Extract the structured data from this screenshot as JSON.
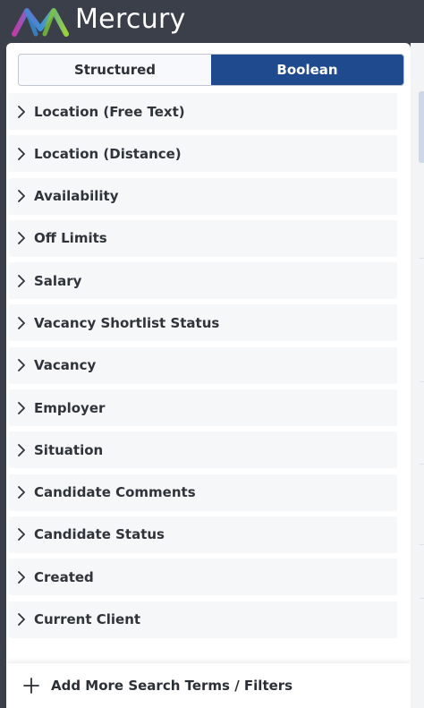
{
  "app": {
    "title": "Mercury"
  },
  "toggle": {
    "structured_label": "Structured",
    "boolean_label": "Boolean",
    "selected": "Boolean"
  },
  "filters": [
    {
      "label": "Location (Free Text)"
    },
    {
      "label": "Location (Distance)"
    },
    {
      "label": "Availability"
    },
    {
      "label": "Off Limits"
    },
    {
      "label": "Salary"
    },
    {
      "label": "Vacancy Shortlist Status"
    },
    {
      "label": "Vacancy"
    },
    {
      "label": "Employer"
    },
    {
      "label": "Situation"
    },
    {
      "label": "Candidate Comments"
    },
    {
      "label": "Candidate Status"
    },
    {
      "label": "Created"
    },
    {
      "label": "Current Client"
    }
  ],
  "footer": {
    "add_label": "Add More Search Terms / Filters"
  },
  "colors": {
    "topbar": "#3a3f4a",
    "active_toggle": "#1f4b8e",
    "item_bg": "#f6f7f9"
  },
  "icons": {
    "chevron": "chevron-right-icon",
    "add": "plus-icon",
    "logo": "mercury-logo-icon"
  }
}
